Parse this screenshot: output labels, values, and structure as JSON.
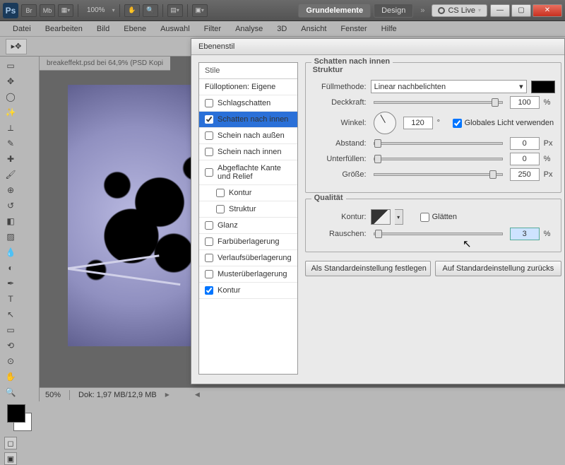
{
  "header": {
    "zoom": "100%",
    "tabs": {
      "grund": "Grundelemente",
      "design": "Design"
    },
    "cslive": "CS Live"
  },
  "menubar": [
    "Datei",
    "Bearbeiten",
    "Bild",
    "Ebene",
    "Auswahl",
    "Filter",
    "Analyse",
    "3D",
    "Ansicht",
    "Fenster",
    "Hilfe"
  ],
  "doc": {
    "tab": "breakeffekt.psd bei 64,9% (PSD Kopi"
  },
  "status": {
    "zoom": "50%",
    "doksize": "Dok: 1,97 MB/12,9 MB"
  },
  "dialog": {
    "title": "Ebenenstil",
    "styles_hdr": "Stile",
    "fillopt": "Fülloptionen: Eigene",
    "items": [
      {
        "label": "Schlagschatten",
        "checked": false
      },
      {
        "label": "Schatten nach innen",
        "checked": true,
        "selected": true
      },
      {
        "label": "Schein nach außen",
        "checked": false
      },
      {
        "label": "Schein nach innen",
        "checked": false
      },
      {
        "label": "Abgeflachte Kante und Relief",
        "checked": false
      },
      {
        "label": "Kontur",
        "checked": false,
        "indent": true
      },
      {
        "label": "Struktur",
        "checked": false,
        "indent": true
      },
      {
        "label": "Glanz",
        "checked": false
      },
      {
        "label": "Farbüberlagerung",
        "checked": false
      },
      {
        "label": "Verlaufsüberlagerung",
        "checked": false
      },
      {
        "label": "Musterüberlagerung",
        "checked": false
      },
      {
        "label": "Kontur",
        "checked": true
      }
    ],
    "panel_title": "Schatten nach innen",
    "struktur": "Struktur",
    "fuellmethode": {
      "label": "Füllmethode:",
      "value": "Linear nachbelichten"
    },
    "deckkraft": {
      "label": "Deckkraft:",
      "value": "100",
      "unit": "%",
      "pos": "92%"
    },
    "winkel": {
      "label": "Winkel:",
      "value": "120",
      "unit": "°"
    },
    "globallight": {
      "label": "Globales Licht verwenden",
      "checked": true
    },
    "abstand": {
      "label": "Abstand:",
      "value": "0",
      "unit": "Px",
      "pos": "0%"
    },
    "unterfuellen": {
      "label": "Unterfüllen:",
      "value": "0",
      "unit": "%",
      "pos": "0%"
    },
    "groesse": {
      "label": "Größe:",
      "value": "250",
      "unit": "Px",
      "pos": "90%"
    },
    "qualitaet": "Qualität",
    "kontur": {
      "label": "Kontur:"
    },
    "glaetten": {
      "label": "Glätten",
      "checked": false
    },
    "rauschen": {
      "label": "Rauschen:",
      "value": "3",
      "unit": "%",
      "pos": "1%"
    },
    "btn_default": "Als Standardeinstellung festlegen",
    "btn_reset": "Auf Standardeinstellung zurücks"
  }
}
